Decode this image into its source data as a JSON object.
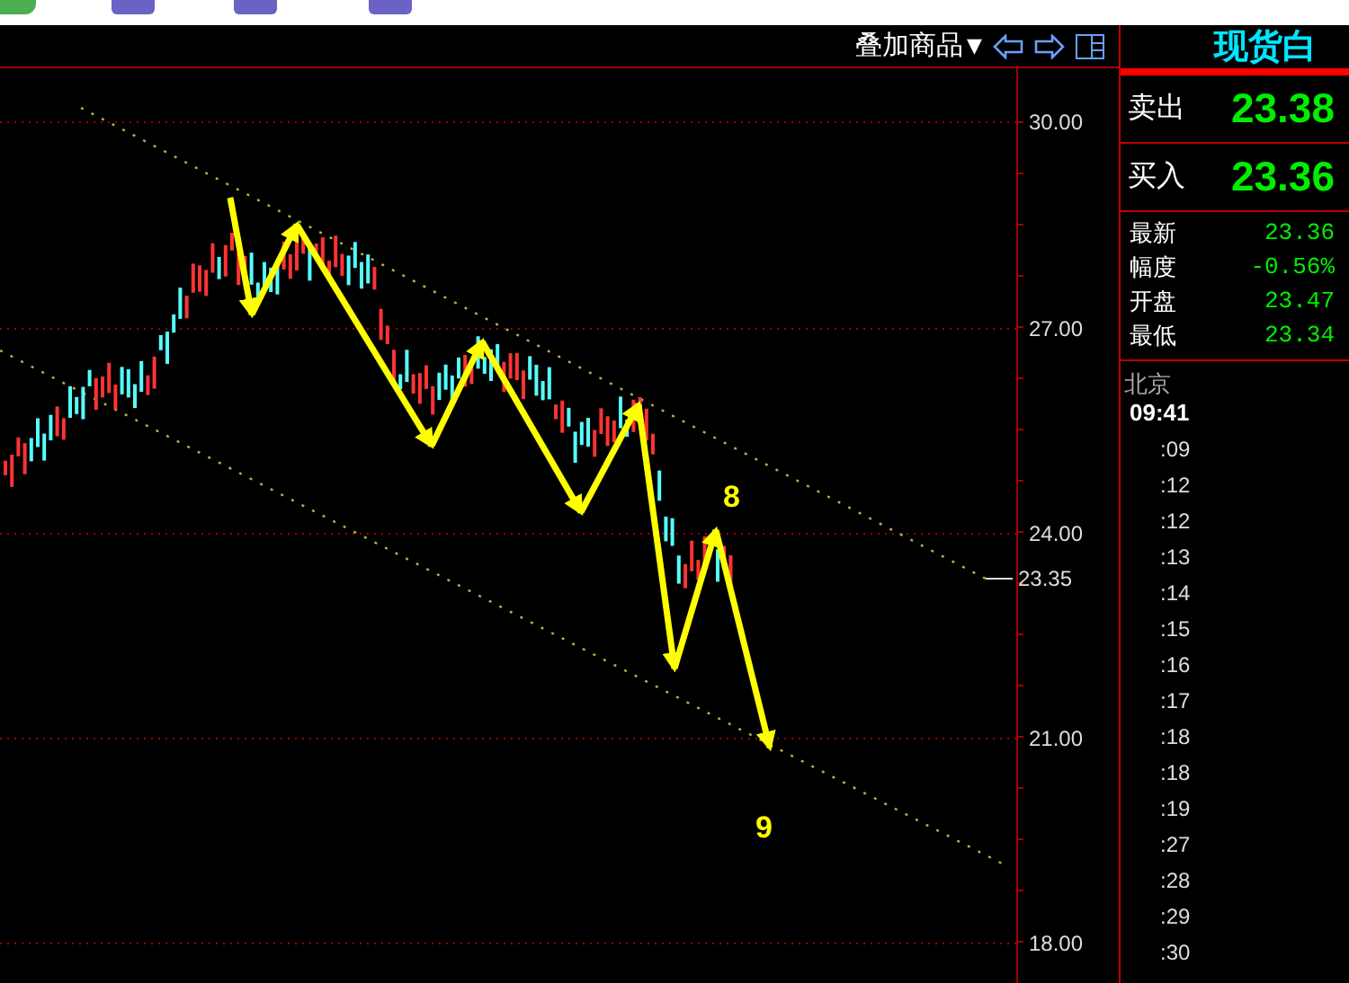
{
  "header": {
    "overlay_menu": "叠加商品",
    "caret": "▼",
    "instrument": "现货白"
  },
  "chart": {
    "price_labels": [
      "30.00",
      "27.00",
      "24.00",
      "21.00",
      "18.00"
    ],
    "current_price": "23.35",
    "wave_labels": [
      "8",
      "9"
    ]
  },
  "quote": {
    "sell": {
      "label": "卖出",
      "value": "23.38"
    },
    "buy": {
      "label": "买入",
      "value": "23.36"
    },
    "stats": [
      {
        "label": "最新",
        "value": "23.36"
      },
      {
        "label": "幅度",
        "value": "-0.56%"
      },
      {
        "label": "开盘",
        "value": "23.47"
      },
      {
        "label": "最低",
        "value": "23.34"
      }
    ]
  },
  "ticks": {
    "city": "北京",
    "time": "09:41",
    "rows": [
      ":09",
      ":12",
      ":12",
      ":13",
      ":14",
      ":15",
      ":16",
      ":17",
      ":18",
      ":18",
      ":19",
      ":27",
      ":28",
      ":29",
      ":30"
    ]
  }
}
